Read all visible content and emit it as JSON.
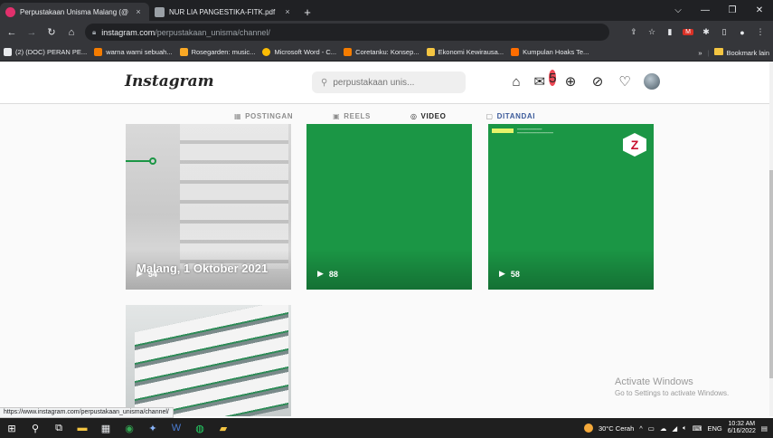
{
  "browser": {
    "tabs": [
      {
        "title": "Perpustakaan Unisma Malang (@",
        "close": "×",
        "active": true,
        "favicon_color": "#e1306c"
      },
      {
        "title": "NUR LIA PANGESTIKA-FITK.pdf",
        "close": "×",
        "active": false,
        "favicon_color": "#9aa0a6"
      }
    ],
    "new_tab": "+",
    "window_controls": {
      "dropdown": "⌵",
      "minimize": "—",
      "maximize": "❐",
      "close": "✕"
    },
    "url_host": "instagram.com",
    "url_path": "/perpustakaan_unisma/channel/",
    "bookmarks": [
      {
        "label": "(2) (DOC) PERAN PE...",
        "color": "#e8eaed"
      },
      {
        "label": "warna warni sebuah...",
        "color": "#f57c00"
      },
      {
        "label": "Rosegarden: music...",
        "color": "#f9a825"
      },
      {
        "label": "Microsoft Word - C...",
        "color": "#fbbc04"
      },
      {
        "label": "Coretanku: Konsep...",
        "color": "#f57c00"
      },
      {
        "label": "Ekonomi Kewirausa...",
        "color": "#f4c542"
      },
      {
        "label": "Kumpulan Hoaks Te...",
        "color": "#ff6d00"
      }
    ],
    "bookmarks_more": "»",
    "bookmarks_other": "Bookmark lain"
  },
  "instagram": {
    "logo": "Instagram",
    "search_placeholder": "perpustakaan unis...",
    "notif_count": "5",
    "tabs": [
      {
        "label": "POSTINGAN",
        "icon": "▦",
        "active": false
      },
      {
        "label": "REELS",
        "icon": "▣",
        "active": false
      },
      {
        "label": "VIDEO",
        "icon": "◎",
        "active": true
      },
      {
        "label": "DITANDAI",
        "icon": "▢",
        "active": false
      }
    ],
    "posts": [
      {
        "caption": "Malang, 1 Oktober 2021",
        "views": "54"
      },
      {
        "views": "88"
      },
      {
        "views": "58"
      }
    ],
    "zlogo_letter": "Z"
  },
  "activate": {
    "title": "Activate Windows",
    "sub": "Go to Settings to activate Windows."
  },
  "status_url": "https://www.instagram.com/perpustakaan_unisma/channel/",
  "taskbar": {
    "weather": "30°C Cerah",
    "lang": "ENG",
    "time": "10:32 AM",
    "date": "6/16/2022"
  }
}
